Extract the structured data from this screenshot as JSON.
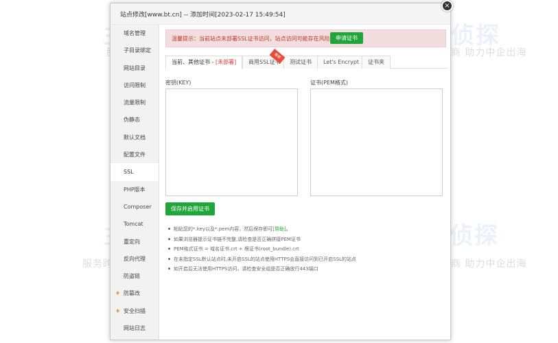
{
  "dialog": {
    "title": "站点修改[www.bt.cn] -- 添加时间[2023-02-17 15:49:54]",
    "close_glyph": "×"
  },
  "watermark": {
    "brand": "主机侦探",
    "slogan": "服务跨境电商 助力中企出海"
  },
  "sidebar": {
    "items": [
      {
        "label": "域名管理",
        "active": false
      },
      {
        "label": "子目录绑定",
        "active": false
      },
      {
        "label": "网站目录",
        "active": false
      },
      {
        "label": "访问限制",
        "active": false
      },
      {
        "label": "流量限制",
        "active": false
      },
      {
        "label": "伪静态",
        "active": false
      },
      {
        "label": "默认文档",
        "active": false
      },
      {
        "label": "配置文件",
        "active": false
      },
      {
        "label": "SSL",
        "active": true
      },
      {
        "label": "PHP版本",
        "active": false
      },
      {
        "label": "Composer",
        "active": false
      },
      {
        "label": "Tomcat",
        "active": false
      },
      {
        "label": "重定向",
        "active": false
      },
      {
        "label": "反向代理",
        "active": false
      },
      {
        "label": "防盗链",
        "active": false
      },
      {
        "label": "防篡改",
        "active": false,
        "icon": "diamond-icon"
      },
      {
        "label": "安全扫描",
        "active": false,
        "icon": "diamond-icon"
      },
      {
        "label": "网站日志",
        "active": false
      }
    ]
  },
  "alert": {
    "text": "温馨提示：当前站点未部署SSL证书访问，站点访问可能存在风险。",
    "button_label": "申请证书",
    "color": "#c0392b"
  },
  "tabs": [
    {
      "label": "当前、其他证书 - ",
      "status": "[未部署]",
      "active": true
    },
    {
      "label": "商用SSL证书",
      "active": false,
      "ribbon": "推荐"
    },
    {
      "label": "测试证书",
      "active": false
    },
    {
      "label": "Let's Encrypt",
      "active": false
    },
    {
      "label": "证书夹",
      "active": false
    }
  ],
  "key_field": {
    "label": "密钥(KEY)",
    "value": ""
  },
  "cert_field": {
    "label": "证书(PEM格式)",
    "value": ""
  },
  "save_button": {
    "label": "保存并启用证书",
    "color": "#20a53a"
  },
  "tips": [
    {
      "text": "粘贴您的*.key以及*.pem内容，然后保存即可",
      "help": "[帮助]",
      "tail": "。"
    },
    {
      "text": "如果浏览器提示证书链不完整,请检查是否正确拼接PEM证书"
    },
    {
      "text": "PEM格式证书 = 域名证书.crt + 根证书(root_bundle).crt"
    },
    {
      "text": "在未指定SSL默认站点时,未开启SSL的站点使用HTTPS会直接访问到已开启SSL的站点"
    },
    {
      "text": "如开启后无法使用HTTPS访问，请检查安全组是否正确放行443端口"
    }
  ]
}
